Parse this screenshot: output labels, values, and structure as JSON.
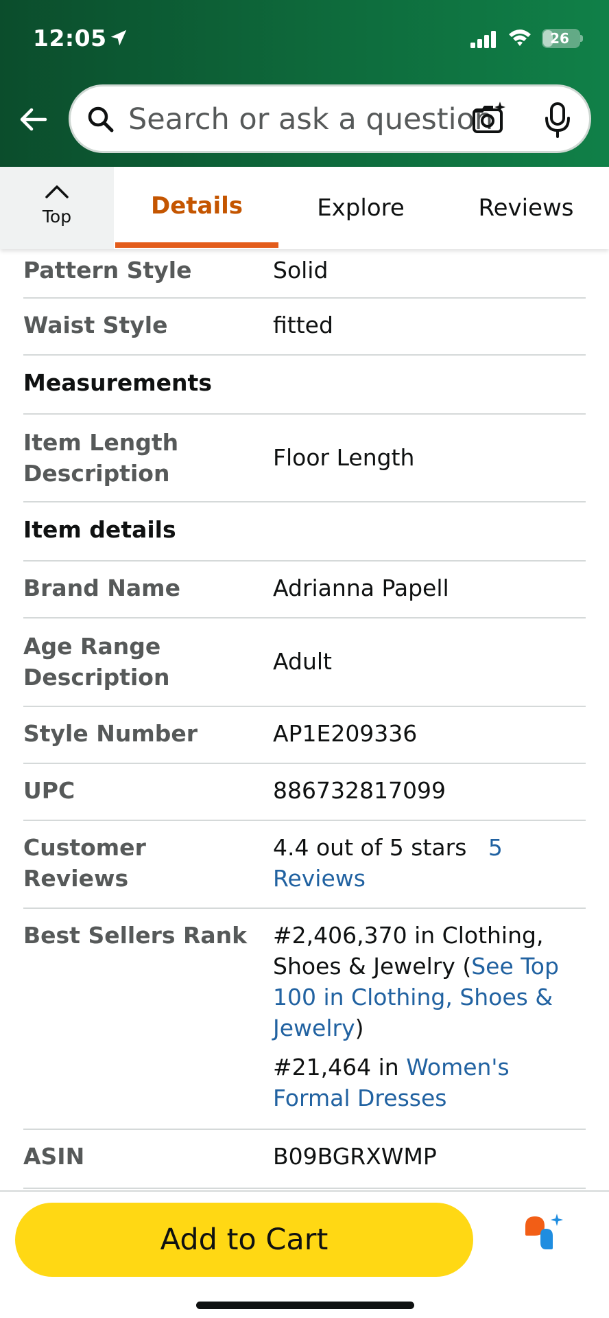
{
  "status_bar": {
    "time": "12:05",
    "battery": "26",
    "battery_level": 0.26,
    "icons": [
      "location-arrow-icon",
      "cellular-signal-icon",
      "wifi-icon",
      "battery-icon"
    ]
  },
  "header": {
    "back_icon": "arrow-left-icon",
    "search": {
      "placeholder": "Search or ask a question",
      "icons": [
        "search-icon",
        "camera-lens-icon",
        "microphone-icon"
      ]
    },
    "colors": {
      "gradient_start": "#0b4d2c",
      "gradient_end": "#108048"
    }
  },
  "tabs": {
    "top_label": "Top",
    "items": [
      {
        "label": "Details",
        "active": true
      },
      {
        "label": "Explore",
        "active": false
      },
      {
        "label": "Reviews",
        "active": false
      }
    ],
    "active_color": "#c45500"
  },
  "details": {
    "pattern_style": {
      "key": "Pattern Style",
      "value": "Solid"
    },
    "waist_style": {
      "key": "Waist Style",
      "value": "fitted"
    },
    "measurements_title": "Measurements",
    "item_length": {
      "key": "Item Length Description",
      "value": "Floor Length"
    },
    "item_details_title": "Item details",
    "brand_name": {
      "key": "Brand Name",
      "value": "Adrianna Papell"
    },
    "age_range": {
      "key": "Age Range Description",
      "value": "Adult"
    },
    "style_number": {
      "key": "Style Number",
      "value": "AP1E209336"
    },
    "upc": {
      "key": "UPC",
      "value": "886732817099"
    },
    "customer_reviews": {
      "key": "Customer Reviews",
      "rating_text": "4.4 out of 5 stars",
      "reviews_link": "5 Reviews"
    },
    "best_sellers": {
      "key": "Best Sellers Rank",
      "rank1_prefix": "#2,406,370 in Clothing, Shoes & Jewelry (",
      "rank1_link": "See Top 100 in Clothing, Shoes & Jewelry",
      "rank1_suffix": ")",
      "rank2_prefix": "#21,464 in ",
      "rank2_link": "Women's Formal Dresses"
    },
    "asin": {
      "key": "ASIN",
      "value": "B09BGRXWMP"
    }
  },
  "bottom_bar": {
    "add_to_cart": "Add to Cart",
    "button_color": "#ffd814",
    "assistant_icon": "rufus-assistant-icon"
  }
}
